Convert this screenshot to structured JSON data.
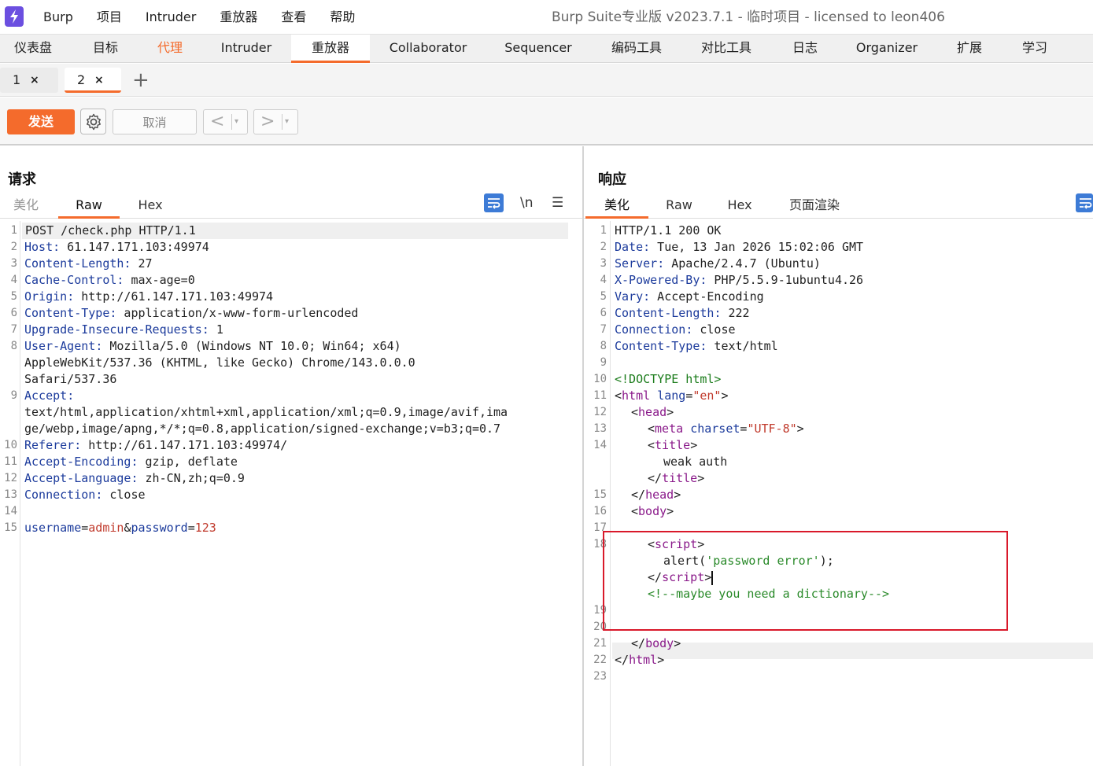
{
  "menubar": {
    "items": [
      "Burp",
      "项目",
      "Intruder",
      "重放器",
      "查看",
      "帮助"
    ],
    "app_title": "Burp Suite专业版  v2023.7.1 - 临时项目 - licensed to leon406"
  },
  "tool_tabs": [
    "仪表盘",
    "目标",
    "代理",
    "Intruder",
    "重放器",
    "Collaborator",
    "Sequencer",
    "编码工具",
    "对比工具",
    "日志",
    "Organizer",
    "扩展",
    "学习"
  ],
  "repeater_tabs": [
    {
      "label": "1",
      "close": "×"
    },
    {
      "label": "2",
      "close": "×"
    }
  ],
  "add_tab": "+",
  "toolbar": {
    "send": "发送",
    "cancel": "取消",
    "prev": "<",
    "next": ">",
    "dropdown": "▾"
  },
  "request": {
    "title": "请求",
    "tabs": [
      "美化",
      "Raw",
      "Hex"
    ],
    "newline_toggle": "\\n",
    "menu_glyph": "☰",
    "line_numbers": [
      "1",
      "2",
      "3",
      "4",
      "5",
      "6",
      "7",
      "8",
      "9",
      "10",
      "11",
      "12",
      "13",
      "14",
      "15"
    ],
    "request_line": "POST /check.php HTTP/1.1",
    "headers": [
      {
        "name": "Host",
        "value": " 61.147.171.103:49974"
      },
      {
        "name": "Content-Length",
        "value": " 27"
      },
      {
        "name": "Cache-Control",
        "value": " max-age=0"
      },
      {
        "name": "Origin",
        "value": " http://61.147.171.103:49974"
      },
      {
        "name": "Content-Type",
        "value": " application/x-www-form-urlencoded"
      },
      {
        "name": "Upgrade-Insecure-Requests",
        "value": " 1"
      },
      {
        "name": "User-Agent",
        "value": " Mozilla/5.0 (Windows NT 10.0; Win64; x64)"
      }
    ],
    "user_agent_cont": [
      "AppleWebKit/537.36 (KHTML, like Gecko) Chrome/143.0.0.0",
      "Safari/537.36"
    ],
    "accept_name": "Accept",
    "accept_value": [
      "text/html,application/xhtml+xml,application/xml;q=0.9,image/avif,ima",
      "ge/webp,image/apng,*/*;q=0.8,application/signed-exchange;v=b3;q=0.7"
    ],
    "headers2": [
      {
        "name": "Referer",
        "value": " http://61.147.171.103:49974/"
      },
      {
        "name": "Accept-Encoding",
        "value": " gzip, deflate"
      },
      {
        "name": "Accept-Language",
        "value": " zh-CN,zh;q=0.9"
      },
      {
        "name": "Connection",
        "value": " close"
      }
    ],
    "body": {
      "p1": "username",
      "eq": "=",
      "v1": "admin",
      "amp": "&",
      "p2": "password",
      "v2": "123"
    }
  },
  "response": {
    "title": "响应",
    "tabs": [
      "美化",
      "Raw",
      "Hex",
      "页面渲染"
    ],
    "line_numbers": [
      "1",
      "2",
      "3",
      "4",
      "5",
      "6",
      "7",
      "8",
      "9",
      "10",
      "11",
      "12",
      "13",
      "14",
      "15",
      "16",
      "17",
      "18",
      "19",
      "20",
      "21",
      "22",
      "23"
    ],
    "status_line": "HTTP/1.1 200 OK",
    "headers": [
      {
        "name": "Date",
        "value": " Tue, 13 Jan 2026 15:02:06 GMT"
      },
      {
        "name": "Server",
        "value": " Apache/2.4.7 (Ubuntu)"
      },
      {
        "name": "X-Powered-By",
        "value": " PHP/5.5.9-1ubuntu4.26"
      },
      {
        "name": "Vary",
        "value": " Accept-Encoding"
      },
      {
        "name": "Content-Length",
        "value": " 222"
      },
      {
        "name": "Connection",
        "value": " close"
      },
      {
        "name": "Content-Type",
        "value": " text/html"
      }
    ],
    "html": {
      "doctype": "<!DOCTYPE html>",
      "html_open": "html",
      "lang_attr": "lang",
      "lang_val": "\"en\"",
      "head": "head",
      "meta": "meta",
      "charset_attr": "charset",
      "charset_val": "\"UTF-8\"",
      "title": "title",
      "title_text": "weak auth",
      "body": "body",
      "script": "script",
      "alert_fn": "alert(",
      "alert_str": "'password error'",
      "alert_end": ");",
      "comment": "<!--maybe you need a dictionary-->"
    }
  }
}
